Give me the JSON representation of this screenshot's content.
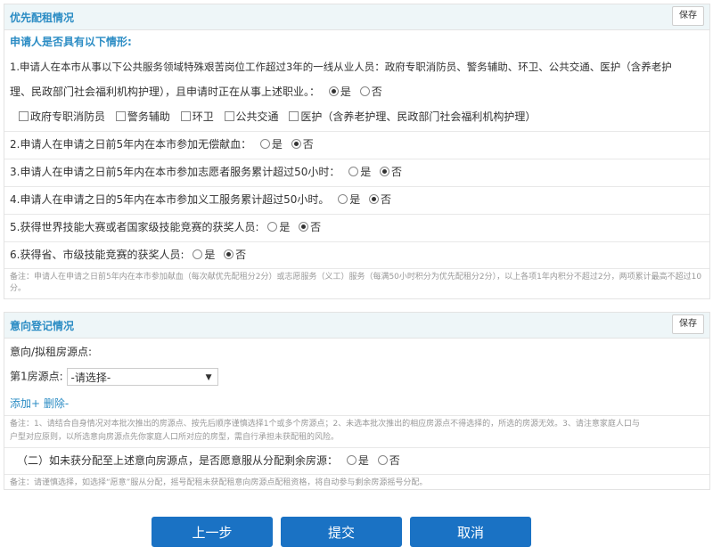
{
  "priority": {
    "title": "优先配租情况",
    "save_label": "保存",
    "subtitle": "申请人是否具有以下情形:",
    "q1_line1": "1.申请人在本市从事以下公共服务领域特殊艰苦岗位工作超过3年的一线从业人员：政府专职消防员、警务辅助、环卫、公共交通、医护（含养老护",
    "q1_line2": "理、民政部门社会福利机构护理），且申请时正在从事上述职业。：",
    "yes": "是",
    "no": "否",
    "checkboxes": [
      "政府专职消防员",
      "警务辅助",
      "环卫",
      "公共交通",
      "医护（含养老护理、民政部门社会福利机构护理）"
    ],
    "q2": "2.申请人在申请之日前5年内在本市参加无偿献血：",
    "q3": "3.申请人在申请之日前5年内在本市参加志愿者服务累计超过50小时：",
    "q4": "4.申请人在申请之日的5年内在本市参加义工服务累计超过50小时。",
    "q5": "5.获得世界技能大赛或者国家级技能竞赛的获奖人员:",
    "q6": "6.获得省、市级技能竞赛的获奖人员:",
    "note": "备注：申请人在申请之日前5年内在本市参加献血（每次献优先配租分2分）或志愿服务（义工）服务（每满50小时积分为优先配租分2分），以上各项1年内积分不超过2分，两项累计最高不超过10分。"
  },
  "intent": {
    "title": "意向登记情况",
    "save_label": "保存",
    "subtitle": "意向/拟租房源点:",
    "house1_label": "第1房源点:",
    "select_value": "-请选择-",
    "add_label": "添加+",
    "delete_label": "删除-",
    "note1_line1": "备注：1、请结合自身情况对本批次推出的房源点、按先后顺序谨慎选择1个或多个房源点；2、未选本批次推出的相应房源点不得选择的，所选的房源无效。3、请注意家庭人口与",
    "note1_line2": "户型对应原则，以所选意向房源点先你家庭人口所对应的房型，需自行承担未获配租的风险。",
    "q_unallocated": "（二）如未获分配至上述意向房源点，是否愿意服从分配剩余房源：",
    "yes": "是",
    "no": "否",
    "note2": "备注：请谨慎选择，如选择“愿意”服从分配，摇号配租未获配租意向房源点配租资格，将自动参与剩余房源摇号分配。"
  },
  "footer": {
    "prev_label": "上一步",
    "submit_label": "提交",
    "cancel_label": "取消"
  }
}
